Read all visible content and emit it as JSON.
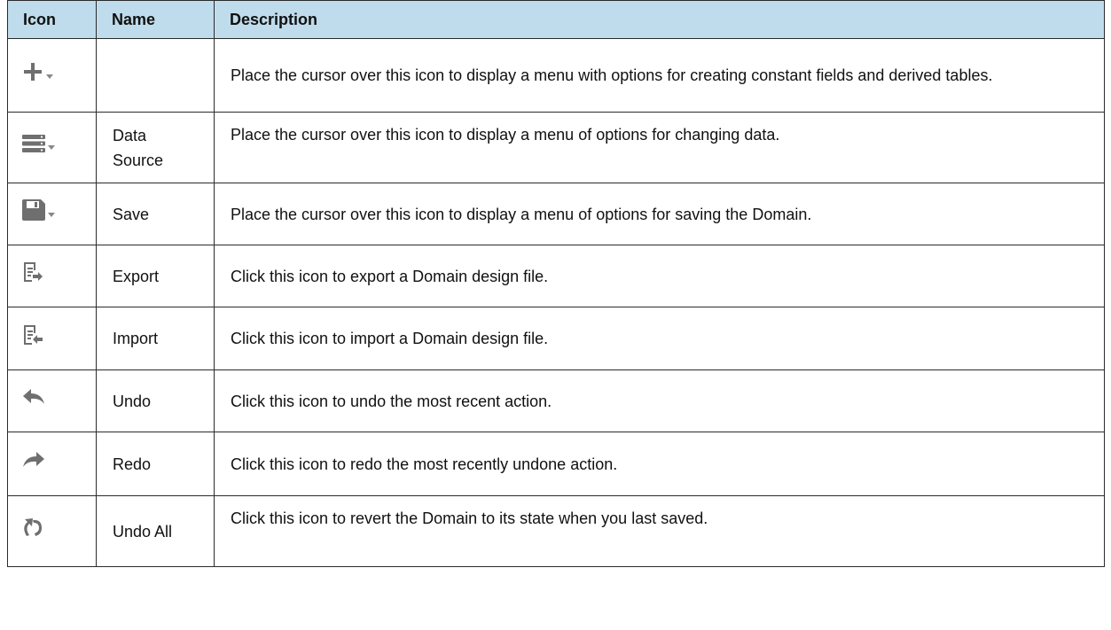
{
  "headers": [
    "Icon",
    "Name",
    "Description"
  ],
  "rows": [
    {
      "icon": "plus-menu-icon",
      "name": "",
      "description": "Place the cursor over this icon to display a menu with options for creating constant fields and derived tables."
    },
    {
      "icon": "data-source-menu-icon",
      "name": "Data Source",
      "description": "Place the cursor over this icon to display a menu of options for changing data."
    },
    {
      "icon": "save-menu-icon",
      "name": "Save",
      "description": "Place the cursor over this icon to display a menu of options for saving the Domain."
    },
    {
      "icon": "export-icon",
      "name": "Export",
      "description": "Click this icon to export a Domain design file."
    },
    {
      "icon": "import-icon",
      "name": "Import",
      "description": "Click this icon to import a Domain design file."
    },
    {
      "icon": "undo-icon",
      "name": "Undo",
      "description": "Click this icon to undo the most recent action."
    },
    {
      "icon": "redo-icon",
      "name": "Redo",
      "description": "Click this icon to redo the most recently undone action."
    },
    {
      "icon": "undo-all-icon",
      "name": "Undo All",
      "description": "Click this icon to revert the Domain to its state when you last saved."
    }
  ],
  "colors": {
    "header_bg": "#bfdcec",
    "icon_gray": "#6f6f6f",
    "border": "#2b2b2b"
  }
}
